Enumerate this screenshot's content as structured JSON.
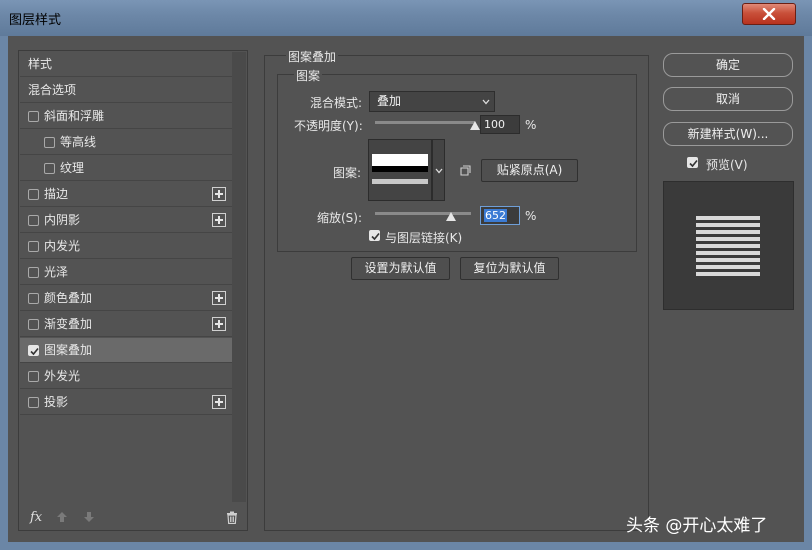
{
  "window": {
    "title": "图层样式"
  },
  "left_list": {
    "items": [
      {
        "label": "样式",
        "checkbox": false,
        "checked": false,
        "plus": false,
        "indent": 0,
        "active": false
      },
      {
        "label": "混合选项",
        "checkbox": false,
        "checked": false,
        "plus": false,
        "indent": 0,
        "active": false
      },
      {
        "label": "斜面和浮雕",
        "checkbox": true,
        "checked": false,
        "plus": false,
        "indent": 0,
        "active": false
      },
      {
        "label": "等高线",
        "checkbox": true,
        "checked": false,
        "plus": false,
        "indent": 1,
        "active": false
      },
      {
        "label": "纹理",
        "checkbox": true,
        "checked": false,
        "plus": false,
        "indent": 1,
        "active": false
      },
      {
        "label": "描边",
        "checkbox": true,
        "checked": false,
        "plus": true,
        "indent": 0,
        "active": false
      },
      {
        "label": "内阴影",
        "checkbox": true,
        "checked": false,
        "plus": true,
        "indent": 0,
        "active": false
      },
      {
        "label": "内发光",
        "checkbox": true,
        "checked": false,
        "plus": false,
        "indent": 0,
        "active": false
      },
      {
        "label": "光泽",
        "checkbox": true,
        "checked": false,
        "plus": false,
        "indent": 0,
        "active": false
      },
      {
        "label": "颜色叠加",
        "checkbox": true,
        "checked": false,
        "plus": true,
        "indent": 0,
        "active": false
      },
      {
        "label": "渐变叠加",
        "checkbox": true,
        "checked": false,
        "plus": true,
        "indent": 0,
        "active": false
      },
      {
        "label": "图案叠加",
        "checkbox": true,
        "checked": true,
        "plus": false,
        "indent": 0,
        "active": true
      },
      {
        "label": "外发光",
        "checkbox": true,
        "checked": false,
        "plus": false,
        "indent": 0,
        "active": false
      },
      {
        "label": "投影",
        "checkbox": true,
        "checked": false,
        "plus": true,
        "indent": 0,
        "active": false
      }
    ],
    "footer": {
      "fx": "fx"
    }
  },
  "pattern_overlay": {
    "group_title": "图案叠加",
    "sub_title": "图案",
    "blend_mode_label": "混合模式:",
    "blend_mode_value": "叠加",
    "opacity_label": "不透明度(Y):",
    "opacity_value": "100",
    "opacity_percent": 100,
    "opacity_unit": "%",
    "pattern_label": "图案:",
    "snap_button": "贴紧原点(A)",
    "scale_label": "缩放(S):",
    "scale_value": "652",
    "scale_unit": "%",
    "link_label": "与图层链接(K)",
    "link_checked": true,
    "make_default": "设置为默认值",
    "reset_default": "复位为默认值"
  },
  "right": {
    "ok": "确定",
    "cancel": "取消",
    "new_style": "新建样式(W)...",
    "preview_label": "预览(V)",
    "preview_checked": true
  },
  "watermark": "头条 @开心太难了"
}
